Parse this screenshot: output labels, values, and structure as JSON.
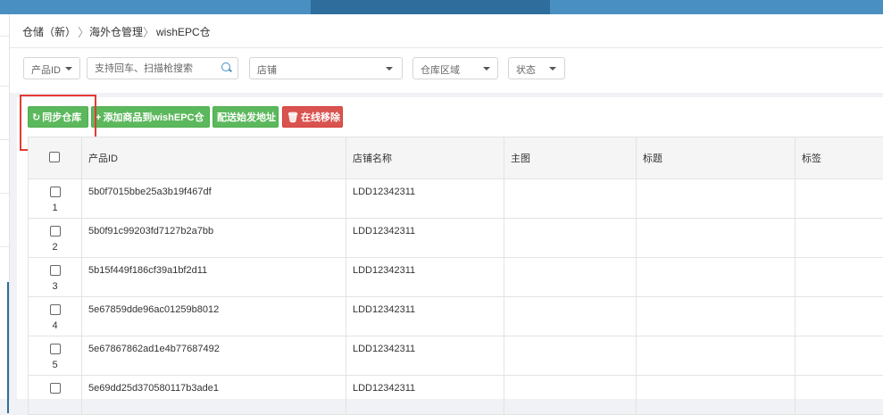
{
  "breadcrumb": {
    "root": "仓储（新）",
    "section": "海外仓管理",
    "current": "wishEPC仓",
    "separator": "〉"
  },
  "filters": {
    "product_id_label": "产品ID",
    "search_placeholder": "支持回车、扫描枪搜索",
    "store_label": "店铺",
    "warehouse_area_label": "仓库区域",
    "status_label": "状态"
  },
  "toolbar": {
    "sync_label": "同步仓库",
    "add_label": "添加商品到wishEPC仓",
    "address_label": "配送始发地址",
    "remove_label": "在线移除"
  },
  "table": {
    "headers": [
      "产品ID",
      "店铺名称",
      "主图",
      "标题",
      "标签"
    ],
    "rows": [
      {
        "num": "1",
        "id": "5b0f7015bbe25a3b19f467df",
        "store": "LDD12342311"
      },
      {
        "num": "2",
        "id": "5b0f91c99203fd7127b2a7bb",
        "store": "LDD12342311"
      },
      {
        "num": "3",
        "id": "5b15f449f186cf39a1bf2d11",
        "store": "LDD12342311"
      },
      {
        "num": "4",
        "id": "5e67859dde96ac01259b8012",
        "store": "LDD12342311"
      },
      {
        "num": "5",
        "id": "5e67867862ad1e4b77687492",
        "store": "LDD12342311"
      },
      {
        "num": "",
        "id": "5e69dd25d370580117b3ade1",
        "store": "LDD12342311"
      }
    ]
  },
  "colors": {
    "primary": "#4a8fc1",
    "success": "#5cb85c",
    "danger": "#d9534f",
    "highlight": "#e53935"
  }
}
